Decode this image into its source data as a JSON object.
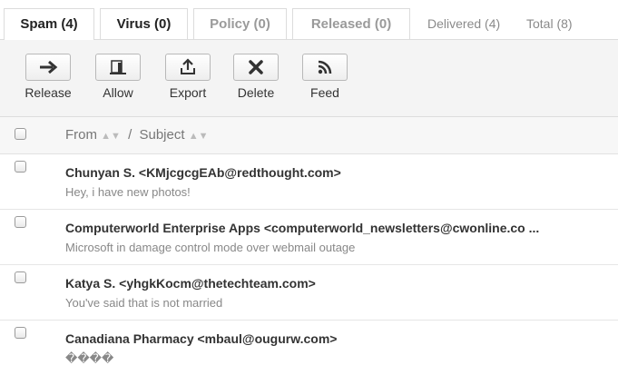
{
  "tabs": [
    {
      "label": "Spam (4)"
    },
    {
      "label": "Virus (0)"
    },
    {
      "label": "Policy (0)"
    },
    {
      "label": "Released (0)"
    },
    {
      "label": "Delivered (4)"
    },
    {
      "label": "Total (8)"
    }
  ],
  "toolbar": {
    "release": "Release",
    "allow": "Allow",
    "export": "Export",
    "delete": "Delete",
    "feed": "Feed"
  },
  "header": {
    "from": "From",
    "separator": "/",
    "subject": "Subject"
  },
  "messages": [
    {
      "from": "Chunyan S. <KMjcgcgEAb@redthought.com>",
      "subject": "Hey, i have new photos!"
    },
    {
      "from": "Computerworld Enterprise Apps <computerworld_newsletters@cwonline.co ...",
      "subject": "Microsoft in damage control mode over webmail outage"
    },
    {
      "from": "Katya S. <yhgkKocm@thetechteam.com>",
      "subject": "You've said that is not married"
    },
    {
      "from": "Canadiana Pharmacy <mbaul@ougurw.com>",
      "subject": "����"
    }
  ],
  "colors": {
    "border": "#dcdcdc",
    "toolbar_bg": "#f4f4f4",
    "icon": "#333333"
  }
}
